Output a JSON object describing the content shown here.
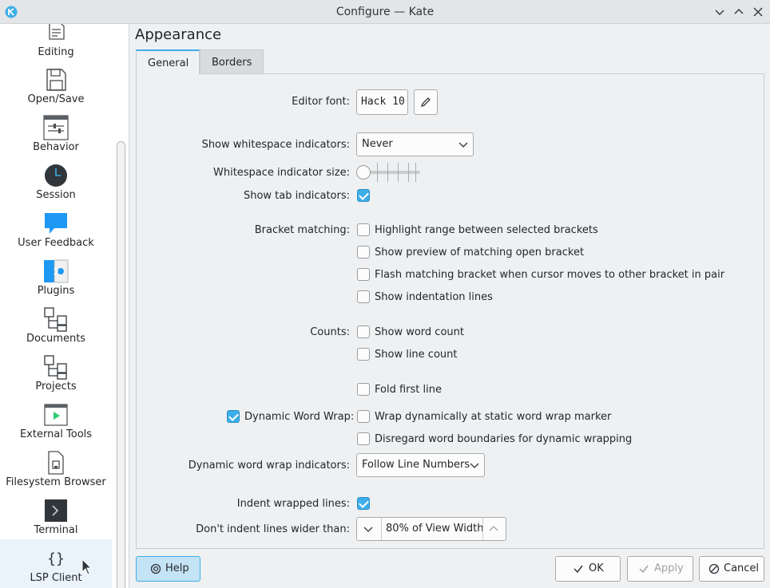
{
  "window": {
    "title": "Configure — Kate"
  },
  "sidebar": {
    "items": [
      {
        "label": "Editing",
        "icon": "editing-icon"
      },
      {
        "label": "Open/Save",
        "icon": "save-icon"
      },
      {
        "label": "Behavior",
        "icon": "behavior-icon"
      },
      {
        "label": "Session",
        "icon": "clock-icon"
      },
      {
        "label": "User Feedback",
        "icon": "feedback-icon"
      },
      {
        "label": "Plugins",
        "icon": "plugins-icon"
      },
      {
        "label": "Documents",
        "icon": "documents-icon"
      },
      {
        "label": "Projects",
        "icon": "projects-icon"
      },
      {
        "label": "External Tools",
        "icon": "external-tools-icon"
      },
      {
        "label": "Filesystem Browser",
        "icon": "filesystem-icon"
      },
      {
        "label": "Terminal",
        "icon": "terminal-icon"
      },
      {
        "label": "LSP Client",
        "icon": "braces-icon"
      }
    ]
  },
  "page": {
    "title": "Appearance"
  },
  "tabs": [
    "General",
    "Borders"
  ],
  "form": {
    "editor_font_label": "Editor font:",
    "editor_font_value": "Hack 10",
    "whitespace_label": "Show whitespace indicators:",
    "whitespace_value": "Never",
    "ws_size_label": "Whitespace indicator size:",
    "ws_size_level": 0,
    "tab_ind_label": "Show tab indicators:",
    "tab_ind_checked": true,
    "bracket_label": "Bracket matching:",
    "bracket_options": [
      {
        "label": "Highlight range between selected brackets",
        "checked": false
      },
      {
        "label": "Show preview of matching open bracket",
        "checked": false
      },
      {
        "label": "Flash matching bracket when cursor moves to other bracket in pair",
        "checked": false
      },
      {
        "label": "Show indentation lines",
        "checked": false
      }
    ],
    "counts_label": "Counts:",
    "counts_options": [
      {
        "label": "Show word count",
        "checked": false
      },
      {
        "label": "Show line count",
        "checked": false
      }
    ],
    "fold_first_line": "Fold first line",
    "dyn_wrap_label": "Dynamic Word Wrap:",
    "dyn_wrap_checked": true,
    "wrap_static": "Wrap dynamically at static word wrap marker",
    "disregard_boundaries": "Disregard word boundaries for dynamic wrapping",
    "dyn_ind_label": "Dynamic word wrap indicators:",
    "dyn_ind_value": "Follow Line Numbers",
    "indent_wrapped_label": "Indent wrapped lines:",
    "indent_wrapped_checked": true,
    "dont_indent_label": "Don't indent lines wider than:",
    "dont_indent_value": "80% of View Width"
  },
  "footer": {
    "help": "Help",
    "ok": "OK",
    "apply": "Apply",
    "cancel": "Cancel"
  },
  "colors": {
    "accent": "#3daee9",
    "bg": "#eff0f1",
    "sidebar_bg": "#ffffff"
  }
}
